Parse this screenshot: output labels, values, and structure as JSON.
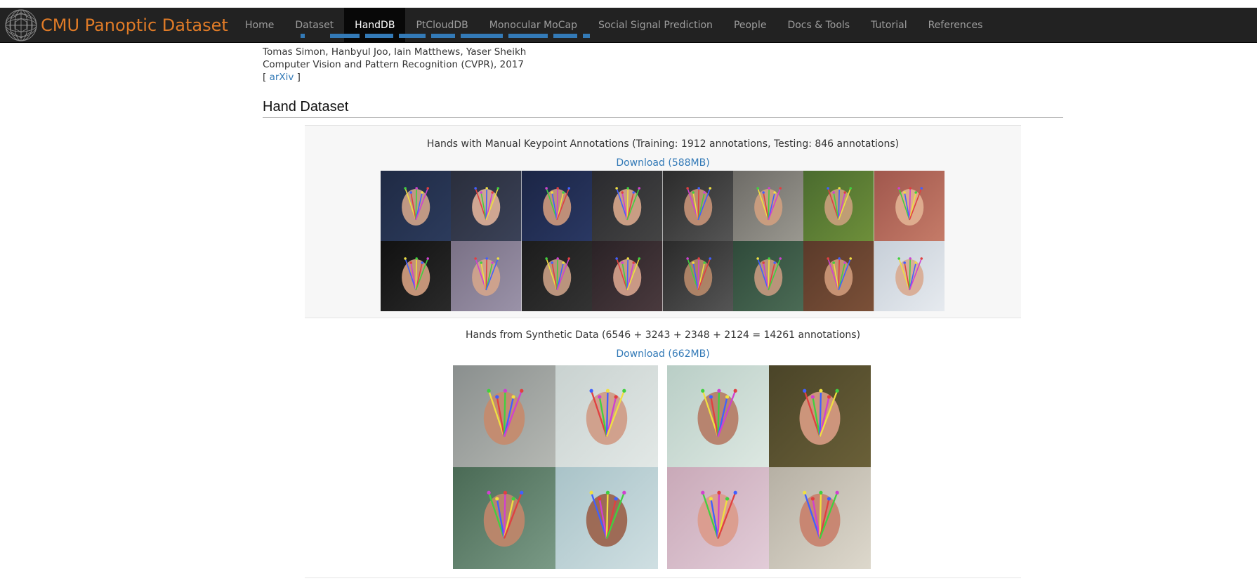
{
  "navbar": {
    "brand": "CMU Panoptic Dataset",
    "items": [
      {
        "label": "Home",
        "active": false
      },
      {
        "label": "Dataset",
        "active": false
      },
      {
        "label": "HandDB",
        "active": true
      },
      {
        "label": "PtCloudDB",
        "active": false
      },
      {
        "label": "Monocular MoCap",
        "active": false
      },
      {
        "label": "Social Signal Prediction",
        "active": false
      },
      {
        "label": "People",
        "active": false
      },
      {
        "label": "Docs & Tools",
        "active": false
      },
      {
        "label": "Tutorial",
        "active": false
      },
      {
        "label": "References",
        "active": false
      }
    ]
  },
  "citation": {
    "authors": "Tomas Simon, Hanbyul Joo, Iain Matthews, Yaser Sheikh",
    "venue": "Computer Vision and Pattern Recognition (CVPR), 2017",
    "link_open": "[ ",
    "link_label": "arXiv",
    "link_close": " ]"
  },
  "section": {
    "title": "Hand Dataset"
  },
  "datasets": [
    {
      "title": "Hands with Manual Keypoint Annotations (Training: 1912 annotations, Testing: 846 annotations)",
      "download_label": "Download (588MB)"
    },
    {
      "title": "Hands from Synthetic Data (6546 + 3243 + 2348 + 2124 = 14261 annotations)",
      "download_label": "Download (662MB)"
    }
  ],
  "colors": {
    "brand": "#e07b27",
    "navbar_bg": "#222222",
    "nav_active_bg": "#080808",
    "link": "#337ab7",
    "block_bg": "#f7f7f7"
  }
}
